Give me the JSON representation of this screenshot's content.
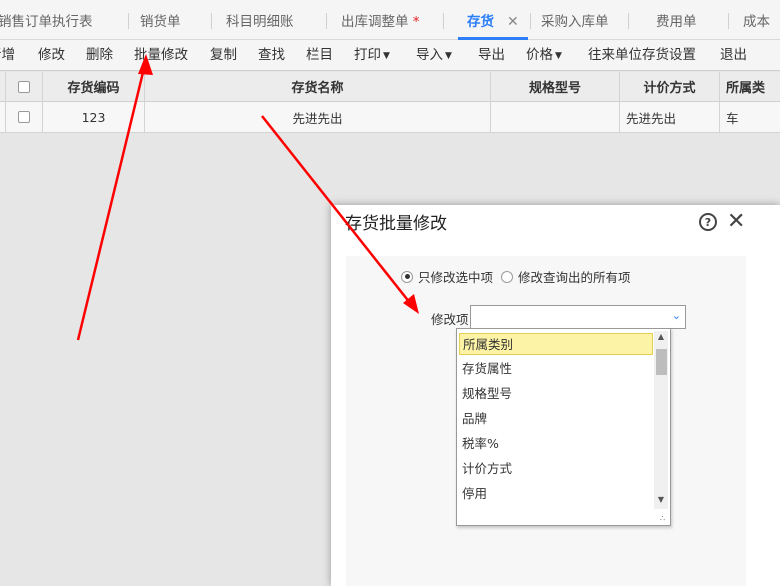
{
  "tabs": [
    {
      "label": "销售订单执行表"
    },
    {
      "label": "销货单"
    },
    {
      "label": "科目明细账"
    },
    {
      "label": "出库调整单",
      "marker": "*"
    },
    {
      "label": "存货",
      "active": true,
      "close": "✕"
    },
    {
      "label": "采购入库单"
    },
    {
      "label": "费用单"
    },
    {
      "label": "成本"
    }
  ],
  "toolbar": {
    "new": "新增",
    "edit": "修改",
    "delete": "删除",
    "batch_edit": "批量修改",
    "copy": "复制",
    "find": "查找",
    "columns": "栏目",
    "print": "打印",
    "import": "导入",
    "export": "导出",
    "price": "价格",
    "partner_stock_settings": "往来单位存货设置",
    "exit": "退出"
  },
  "table": {
    "headers": [
      "存货编码",
      "存货名称",
      "规格型号",
      "计价方式",
      "所属类"
    ],
    "rows": [
      {
        "code": "123",
        "name": "先进先出",
        "spec": "",
        "costing": "先进先出",
        "category": "车"
      }
    ]
  },
  "dialog": {
    "title": "存货批量修改",
    "help_glyph": "?",
    "close_glyph": "✕",
    "radio_selected": "只修改选中项",
    "radio_all": "修改查询出的所有项",
    "field_label": "修改项",
    "select_value": "",
    "options": [
      "所属类别",
      "存货属性",
      "规格型号",
      "品牌",
      "税率%",
      "计价方式",
      "停用"
    ]
  },
  "colors": {
    "accent": "#2d7ff9",
    "highlight": "#fdf3a6",
    "annotation": "#ff0000"
  }
}
